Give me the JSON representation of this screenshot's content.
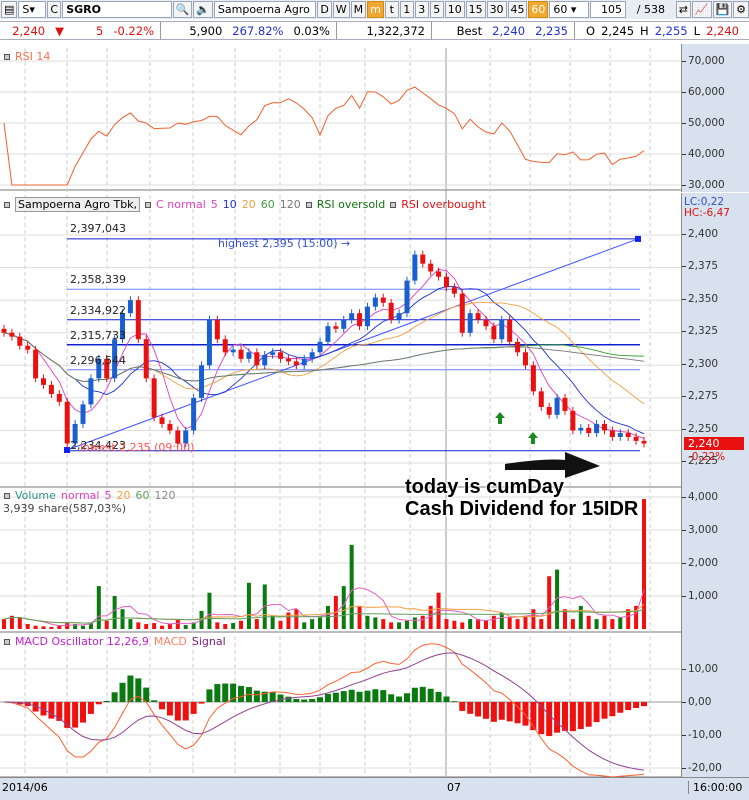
{
  "toolbar": {
    "market": "S",
    "c_label": "C",
    "symbol": "SGRO",
    "company": "Sampoerna Agro",
    "periods": [
      "D",
      "W",
      "M",
      "m",
      "t"
    ],
    "active_period": "m",
    "intervals": [
      "1",
      "3",
      "5",
      "10",
      "15",
      "30",
      "45",
      "60"
    ],
    "active_interval": "60",
    "interval_select": "60",
    "bar_count": "105",
    "total_label": "/ 538"
  },
  "quote": {
    "price": "2,240",
    "arrow": "▼",
    "change": "5",
    "change_pct": "-0.22%",
    "volume_val": "5,900",
    "vol_ratio": "267.82%",
    "turnover": "0.03%",
    "amount": "1,322,372",
    "best_label": "Best",
    "best_bid": "2,240",
    "best_ask": "2,235",
    "o_label": "O",
    "open": "2,245",
    "h_label": "H",
    "high": "2,255",
    "l_label": "L",
    "low": "2,240"
  },
  "rsi_panel": {
    "title": "RSI 14",
    "axis": [
      "70,000",
      "60,000",
      "50,000",
      "40,000",
      "30,000"
    ]
  },
  "price_panel": {
    "legend_name": "Sampoerna Agro Tbk,",
    "legend_type": "C normal",
    "ma": [
      "5",
      "10",
      "20",
      "60",
      "120"
    ],
    "rsi_oversold": "RSI oversold",
    "rsi_overbought": "RSI overbought",
    "lc": "LC:0,22",
    "hc": "HC:-6,47",
    "axis": [
      "2,400",
      "2,375",
      "2,350",
      "2,325",
      "2,300",
      "2,275",
      "2,250",
      "2,225"
    ],
    "current_price": "2,240",
    "current_change": "-0,22%",
    "highest_note": "highest 2,395 (15:00) →",
    "lowest_note": "lowest 2,235 (09:00)",
    "levels": [
      "2,397,043",
      "2,358,339",
      "2,334,922",
      "2,315,733",
      "2,296,544",
      "2,234,423"
    ]
  },
  "annotation": {
    "line1": "today is cumDay",
    "line2": "Cash Dividend for 15IDR"
  },
  "volume_panel": {
    "title": "Volume",
    "type": "normal",
    "ma": [
      "5",
      "20",
      "60",
      "120"
    ],
    "last": "3,939 share(587,03%)",
    "axis": [
      "4,000",
      "3,000",
      "2,000",
      "1,000"
    ]
  },
  "macd_panel": {
    "title": "MACD Oscillator 12,26,9",
    "macd": "MACD",
    "signal": "Signal",
    "axis": [
      "10,00",
      "0,00",
      "-10,00",
      "-20,00"
    ]
  },
  "xaxis": {
    "start": "2014/06",
    "mid": "07",
    "time": "16:00:00"
  },
  "colors": {
    "up": "#1a5fd0",
    "down": "#e81010",
    "vol_up": "#0a7a10",
    "vol_down": "#f01010"
  },
  "chart_data": {
    "type": "candlestick",
    "title": "Sampoerna Agro Tbk, 60 min",
    "levels": [
      2397.043,
      2358.339,
      2334.922,
      2315.733,
      2296.544,
      2234.423
    ],
    "ylim": [
      2215,
      2410
    ],
    "open": [
      2328,
      2325,
      2322,
      2315,
      2312,
      2290,
      2285,
      2278,
      2272,
      2240,
      2255,
      2270,
      2290,
      2305,
      2290,
      2320,
      2340,
      2350,
      2320,
      2290,
      2260,
      2255,
      2250,
      2240,
      2250,
      2275,
      2300,
      2335,
      2320,
      2310,
      2312,
      2305,
      2310,
      2300,
      2308,
      2310,
      2305,
      2303,
      2300,
      2305,
      2310,
      2318,
      2330,
      2328,
      2335,
      2340,
      2330,
      2345,
      2352,
      2348,
      2335,
      2340,
      2365,
      2385,
      2378,
      2372,
      2368,
      2360,
      2355,
      2325,
      2340,
      2335,
      2330,
      2320,
      2335,
      2318,
      2310,
      2300,
      2280,
      2268,
      2262,
      2275,
      2265,
      2250,
      2252,
      2248,
      2255,
      2250,
      2245,
      2248,
      2245,
      2242
    ],
    "close": [
      2325,
      2322,
      2315,
      2312,
      2290,
      2285,
      2278,
      2272,
      2240,
      2255,
      2270,
      2290,
      2305,
      2290,
      2320,
      2340,
      2350,
      2320,
      2290,
      2260,
      2255,
      2250,
      2240,
      2250,
      2275,
      2300,
      2335,
      2320,
      2310,
      2312,
      2305,
      2310,
      2300,
      2308,
      2310,
      2305,
      2303,
      2300,
      2305,
      2310,
      2318,
      2330,
      2328,
      2335,
      2340,
      2330,
      2345,
      2352,
      2348,
      2335,
      2340,
      2365,
      2385,
      2378,
      2372,
      2368,
      2360,
      2355,
      2325,
      2340,
      2335,
      2330,
      2320,
      2335,
      2318,
      2310,
      2300,
      2280,
      2268,
      2262,
      2275,
      2265,
      2250,
      2252,
      2248,
      2255,
      2250,
      2245,
      2248,
      2245,
      2242,
      2240
    ],
    "volume": [
      300,
      400,
      350,
      150,
      100,
      80,
      60,
      120,
      200,
      150,
      100,
      200,
      1300,
      250,
      1000,
      600,
      300,
      200,
      150,
      180,
      100,
      150,
      300,
      120,
      200,
      550,
      1100,
      200,
      150,
      180,
      250,
      1400,
      300,
      1350,
      400,
      250,
      500,
      600,
      200,
      300,
      350,
      700,
      1000,
      1300,
      2550,
      700,
      400,
      350,
      300,
      200,
      200,
      250,
      350,
      400,
      700,
      1100,
      300,
      250,
      200,
      300,
      300,
      250,
      400,
      500,
      350,
      300,
      400,
      600,
      300,
      1600,
      1800,
      600,
      300,
      700,
      400,
      300,
      400,
      300,
      350,
      600,
      700,
      3939
    ]
  }
}
